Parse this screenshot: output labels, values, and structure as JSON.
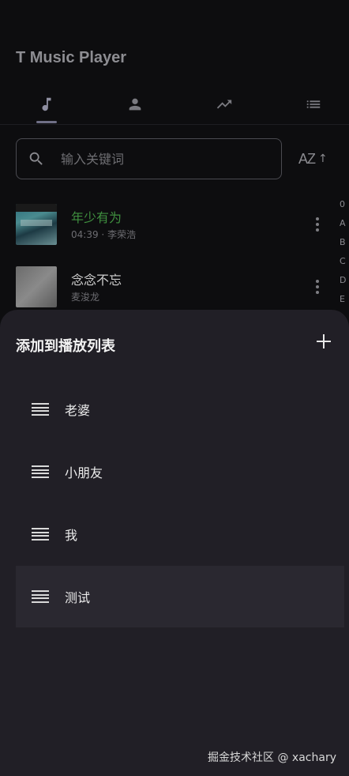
{
  "app": {
    "title": "T Music Player"
  },
  "tabs": [
    {
      "icon": "music-note-icon"
    },
    {
      "icon": "person-icon"
    },
    {
      "icon": "trending-up-icon"
    },
    {
      "icon": "list-icon"
    }
  ],
  "search": {
    "placeholder": "输入关键词",
    "value": ""
  },
  "sort": {
    "label": "AZ",
    "arrow": "↑"
  },
  "songs": [
    {
      "title": "年少有为",
      "duration": "04:39",
      "artist": "李荣浩",
      "title_color": "#3f8f3f"
    },
    {
      "title": "念念不忘",
      "duration": "",
      "artist": "麦浚龙",
      "title_color": "#cfcfcf"
    }
  ],
  "index_letters": [
    "0",
    "A",
    "B",
    "C",
    "D",
    "E"
  ],
  "sheet": {
    "title": "添加到播放列表",
    "playlists": [
      {
        "label": "老婆"
      },
      {
        "label": "小朋友"
      },
      {
        "label": "我"
      },
      {
        "label": "测试"
      }
    ]
  },
  "watermark": "掘金技术社区 @ xachary"
}
